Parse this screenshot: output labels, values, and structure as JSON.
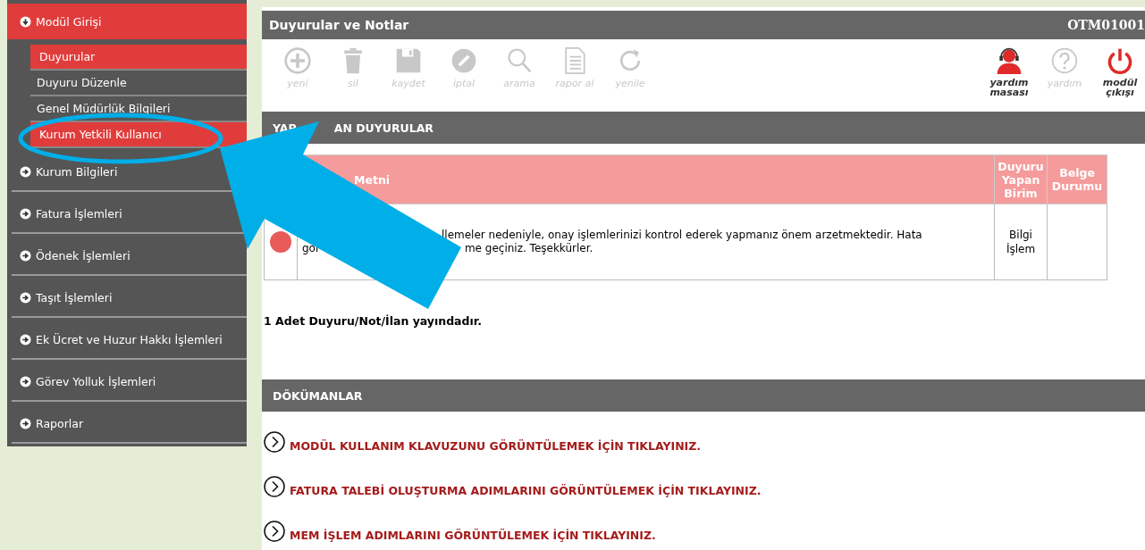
{
  "sidebar": {
    "items": [
      {
        "label": "Modül Girişi",
        "expanded": true,
        "children": [
          {
            "label": "Duyurular",
            "selected": true
          },
          {
            "label": "Duyuru Düzenle",
            "selected": false
          },
          {
            "label": "Genel Müdürlük Bilgileri",
            "selected": false
          },
          {
            "label": "Kurum Yetkili Kullanıcı",
            "selected": true
          }
        ]
      },
      {
        "label": "Kurum Bilgileri",
        "expanded": false
      },
      {
        "label": "Fatura İşlemleri",
        "expanded": false
      },
      {
        "label": "Ödenek İşlemleri",
        "expanded": false
      },
      {
        "label": "Taşıt İşlemleri",
        "expanded": false
      },
      {
        "label": "Ek Ücret ve Huzur Hakkı İşlemleri",
        "expanded": false
      },
      {
        "label": "Görev Yolluk İşlemleri",
        "expanded": false
      },
      {
        "label": "Raporlar",
        "expanded": false
      }
    ]
  },
  "window": {
    "title": "Duyurular ve Notlar",
    "code": "OTM01001"
  },
  "toolbar": {
    "left": [
      {
        "kind": "new",
        "label": "yeni",
        "disabled": true
      },
      {
        "kind": "delete",
        "label": "sil",
        "disabled": true
      },
      {
        "kind": "save",
        "label": "kaydet",
        "disabled": true
      },
      {
        "kind": "cancel",
        "label": "iptal",
        "disabled": true
      },
      {
        "kind": "search",
        "label": "arama",
        "disabled": true
      },
      {
        "kind": "report",
        "label": "rapor al",
        "disabled": true
      },
      {
        "kind": "refresh",
        "label": "yenile",
        "disabled": true
      }
    ],
    "right": [
      {
        "kind": "helpdesk",
        "label": "yardım masası",
        "disabled": false
      },
      {
        "kind": "help",
        "label": "yardım",
        "disabled": true
      },
      {
        "kind": "exit",
        "label": "modül çıkışı",
        "disabled": false
      }
    ]
  },
  "announcements": {
    "header_parts": [
      "YAP",
      "AN DUYURULAR"
    ],
    "columns": [
      "Metni",
      "Duyuru Yapan Birim",
      "Belge Durumu"
    ],
    "rows": [
      {
        "color": "#e85a5a",
        "line_1": "llemeler nedeniyle, onay işlemlerinizi kontrol ederek yapmanız önem arzetmektedir. Hata",
        "line_2_parts": [
          "gör",
          "me geçiniz. Teşekkürler."
        ],
        "unit": "Bilgi İşlem"
      }
    ],
    "count_text": "1 Adet Duyuru/Not/İlan yayındadır."
  },
  "documents": {
    "header": "DÖKÜMANLAR",
    "links": [
      "MODÜL KULLANIM KLAVUZUNU GÖRÜNTÜLEMEK İÇİN TIKLAYINIZ.",
      "FATURA TALEBİ OLUŞTURMA ADIMLARINI GÖRÜNTÜLEMEK İÇİN TIKLAYINIZ.",
      "MEM İŞLEM ADIMLARINI GÖRÜNTÜLEMEK İÇİN TIKLAYINIZ."
    ]
  }
}
